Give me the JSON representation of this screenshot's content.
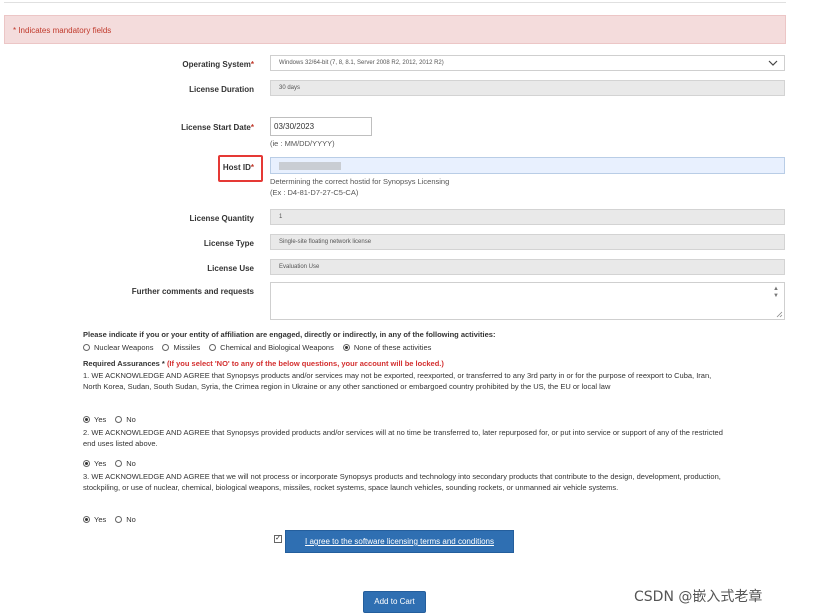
{
  "mandatory_note": "* Indicates mandatory fields",
  "form": {
    "operating_system": {
      "label": "Operating System",
      "required_mark": "*",
      "value": "Windows 32/64-bit (7, 8, 8.1, Server 2008 R2, 2012, 2012 R2)"
    },
    "license_duration": {
      "label": "License Duration",
      "value": "30 days"
    },
    "license_start_date": {
      "label": "License Start Date",
      "required_mark": "*",
      "value": "03/30/2023",
      "hint": "(ie : MM/DD/YYYY)"
    },
    "host_id": {
      "label": "Host ID",
      "required_mark": "*",
      "help_line1": "Determining the correct hostid for Synopsys Licensing",
      "help_line2": "(Ex : D4-81-D7-27-C5-CA)"
    },
    "license_quantity": {
      "label": "License Quantity",
      "value": "1"
    },
    "license_type": {
      "label": "License Type",
      "value": "Single-site floating network license"
    },
    "license_use": {
      "label": "License Use",
      "value": "Evaluation Use"
    },
    "comments": {
      "label": "Further comments and requests",
      "value": ""
    }
  },
  "activities": {
    "question": "Please indicate if you or your entity of affiliation are engaged, directly or indirectly, in any of the following activities:",
    "options": [
      "Nuclear Weapons",
      "Missiles",
      "Chemical and Biological Weapons",
      "None of these activities"
    ],
    "selected": "None of these activities"
  },
  "assurances": {
    "title": "Required Assurances *",
    "warning": "(If you select 'NO' to any of the below questions, your account will be locked.)",
    "items": [
      {
        "text": "1. WE ACKNOWLEDGE AND AGREE that Synopsys products and/or services may not be exported, reexported, or transferred to any 3rd party in or for the purpose of reexport to Cuba, Iran, North Korea, Sudan, South Sudan, Syria, the Crimea region in Ukraine or any other sanctioned or embargoed country prohibited by the US, the EU or local law",
        "yes": "Yes",
        "no": "No",
        "selected": "Yes"
      },
      {
        "text": "2. WE ACKNOWLEDGE AND AGREE that Synopsys provided products and/or services will at no time be transferred to, later repurposed for, or put into service or support of any of the restricted end uses listed above.",
        "yes": "Yes",
        "no": "No",
        "selected": "Yes"
      },
      {
        "text": "3. WE ACKNOWLEDGE AND AGREE that we will not process or incorporate Synopsys products and technology into secondary products that contribute to the design, development, production, stockpiling, or use of nuclear, chemical, biological weapons, missiles, rocket systems, space launch vehicles, sounding rockets, or unmanned air vehicle systems.",
        "yes": "Yes",
        "no": "No",
        "selected": "Yes"
      }
    ]
  },
  "agree": {
    "checked": true,
    "check_glyph": "✓",
    "button_label": "I agree to the software licensing terms and conditions"
  },
  "add_to_cart_label": "Add to Cart",
  "watermark": "CSDN @嵌入式老章",
  "colors": {
    "accent": "#2f6fb2",
    "required": "#c0392b",
    "highlight": "#e53935",
    "mandatory_bg": "#f4dcdc"
  }
}
